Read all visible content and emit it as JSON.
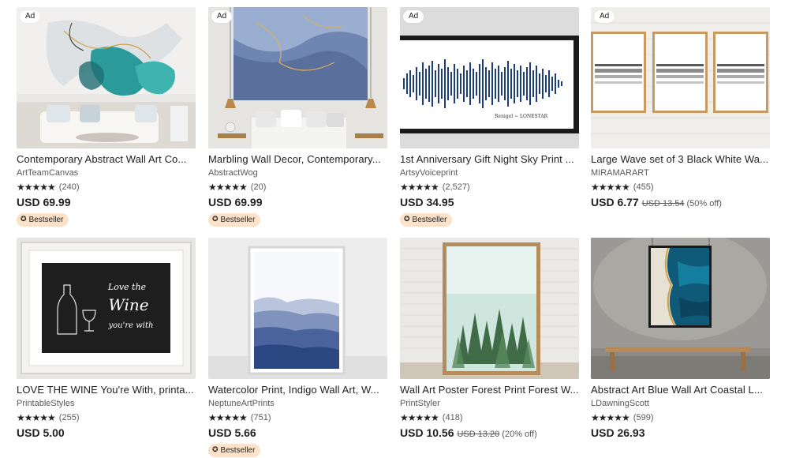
{
  "listings": [
    [
      {
        "ad_label": "Ad",
        "title": "Contemporary Abstract Wall Art Co...",
        "shop": "ArtTeamCanvas",
        "stars": "★★★★★",
        "reviews": "(240)",
        "price": "USD 69.99",
        "old_price": "",
        "discount": "",
        "badge": "Bestseller",
        "badge_icon": "medal-icon"
      },
      {
        "ad_label": "Ad",
        "title": "Marbling Wall Decor, Contemporary...",
        "shop": "AbstractWog",
        "stars": "★★★★★",
        "reviews": "(20)",
        "price": "USD 69.99",
        "old_price": "",
        "discount": "",
        "badge": "Bestseller",
        "badge_icon": "medal-icon"
      },
      {
        "ad_label": "Ad",
        "title": "1st Anniversary Gift Night Sky Print ...",
        "shop": "ArtsyVoiceprint",
        "stars": "★★★★★",
        "reviews": "(2,527)",
        "price": "USD 34.95",
        "old_price": "",
        "discount": "",
        "badge": "Bestseller",
        "badge_icon": "medal-icon",
        "print_caption": "Renigel ~ LONESTAR"
      },
      {
        "ad_label": "Ad",
        "title": "Large Wave set of 3 Black White Wa...",
        "shop": "MIRAMARART",
        "stars": "★★★★★",
        "reviews": "(455)",
        "price": "USD 6.77",
        "old_price": "USD 13.54",
        "discount": "(50% off)",
        "badge": "",
        "badge_icon": ""
      }
    ],
    [
      {
        "ad_label": "",
        "title": "LOVE THE WINE You're With, printa...",
        "shop": "PrintableStyles",
        "stars": "★★★★★",
        "reviews": "(255)",
        "price": "USD 5.00",
        "old_price": "",
        "discount": "",
        "badge": "",
        "badge_icon": "",
        "print_text": [
          "Love the",
          "Wine",
          "you're with"
        ]
      },
      {
        "ad_label": "",
        "title": "Watercolor Print, Indigo Wall Art, W...",
        "shop": "NeptuneArtPrints",
        "stars": "★★★★★",
        "reviews": "(751)",
        "price": "USD 5.66",
        "old_price": "",
        "discount": "",
        "badge": "Bestseller",
        "badge_icon": "medal-icon"
      },
      {
        "ad_label": "",
        "title": "Wall Art Poster Forest Print Forest W...",
        "shop": "PrintStyler",
        "stars": "★★★★★",
        "reviews": "(418)",
        "price": "USD 10.56",
        "old_price": "USD 13.20",
        "discount": "(20% off)",
        "badge": "",
        "badge_icon": ""
      },
      {
        "ad_label": "",
        "title": "Abstract Art Blue Wall Art Coastal L...",
        "shop": "LDawningScott",
        "stars": "★★★★★",
        "reviews": "(599)",
        "price": "USD 26.93",
        "old_price": "",
        "discount": "",
        "badge": "",
        "badge_icon": ""
      }
    ]
  ],
  "colors": {
    "badge_bg": "#fbe2c8",
    "text": "#222222",
    "muted": "#595959"
  }
}
